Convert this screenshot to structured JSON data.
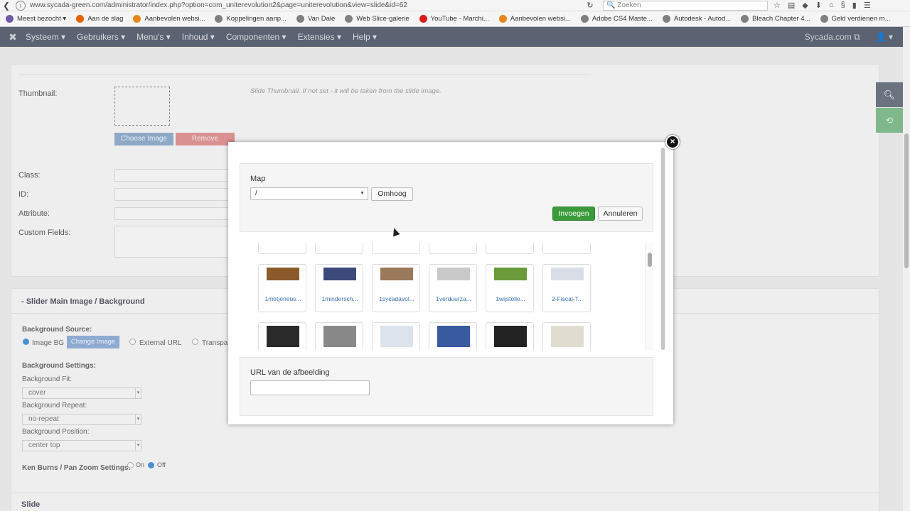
{
  "browser": {
    "url": "www.sycada-green.com/administrator/index.php?option=com_uniterevolution2&page=uniterevolution&view=slide&id=62",
    "search_placeholder": "Zoeken",
    "bookmarks": [
      {
        "label": "Meest bezocht ▾",
        "color": "#6f5aa6"
      },
      {
        "label": "Aan de slag",
        "color": "#e66000"
      },
      {
        "label": "Aanbevolen websi...",
        "color": "#e8861b"
      },
      {
        "label": "Koppelingen aanp...",
        "color": "#808080"
      },
      {
        "label": "Van Dale",
        "color": "#808080"
      },
      {
        "label": "Web Slice-galerie",
        "color": "#808080"
      },
      {
        "label": "YouTube - Marchi...",
        "color": "#d62020"
      },
      {
        "label": "Aanbevolen websi...",
        "color": "#e8861b"
      },
      {
        "label": "Adobe CS4 Maste...",
        "color": "#808080"
      },
      {
        "label": "Autodesk - Autod...",
        "color": "#808080"
      },
      {
        "label": "Bleach  Chapter 4...",
        "color": "#808080"
      },
      {
        "label": "Geld verdienen m...",
        "color": "#808080"
      }
    ]
  },
  "navbar": {
    "menu": [
      "Systeem ▾",
      "Gebruikers ▾",
      "Menu's ▾",
      "Inhoud ▾",
      "Componenten ▾",
      "Extensies ▾",
      "Help ▾"
    ],
    "site": "Sycada.com ⧉",
    "user": "👤 ▾"
  },
  "background": {
    "thumbnail_label": "Thumbnail:",
    "thumbnail_hint": "Slide Thumbnail. If not set - it will be taken from the slide image.",
    "choose_image": "Choose Image",
    "remove": "Remove",
    "class_label": "Class:",
    "id_label": "ID:",
    "attribute_label": "Attribute:",
    "custom_fields_label": "Custom Fields:",
    "main_image_title": "-   Slider Main Image / Background",
    "bg_source_label": "Background Source:",
    "image_bg": "Image BG",
    "change_image": "Change Image",
    "external_url": "External URL",
    "transparent": "Transpar",
    "bg_settings_label": "Background Settings:",
    "bg_fit_label": "Background Fit:",
    "bg_fit_value": "cover",
    "bg_repeat_label": "Background Repeat:",
    "bg_repeat_value": "no-repeat",
    "bg_position_label": "Background Position:",
    "bg_position_value": "center top",
    "ken_burns_label": "Ken Burns / Pan Zoom Settings:",
    "on": "On",
    "off": "Off",
    "slide_title": "Slide"
  },
  "modal": {
    "map_label": "Map",
    "map_value": "/",
    "up_button": "Omhoog",
    "insert_button": "Invoegen",
    "cancel_button": "Annuleren",
    "url_label": "URL van de afbeelding",
    "url_value": "",
    "files": [
      {
        "name": "1metjeneus...",
        "color": "#8a5a2b"
      },
      {
        "name": "1mindersch...",
        "color": "#3b4a7a"
      },
      {
        "name": "1sycadavol...",
        "color": "#9a7a5a"
      },
      {
        "name": "1verduurza...",
        "color": "#c9c9c9"
      },
      {
        "name": "1wijstelle...",
        "color": "#6a9a3a"
      },
      {
        "name": "2-Fiscal-T...",
        "color": "#d9dde6"
      },
      {
        "name": "",
        "color": "#2a2a2a"
      },
      {
        "name": "",
        "color": "#888888"
      },
      {
        "name": "",
        "color": "#dde4ee"
      },
      {
        "name": "",
        "color": "#3a5aa0"
      },
      {
        "name": "",
        "color": "#222222"
      },
      {
        "name": "",
        "color": "#e0dccf"
      }
    ]
  }
}
